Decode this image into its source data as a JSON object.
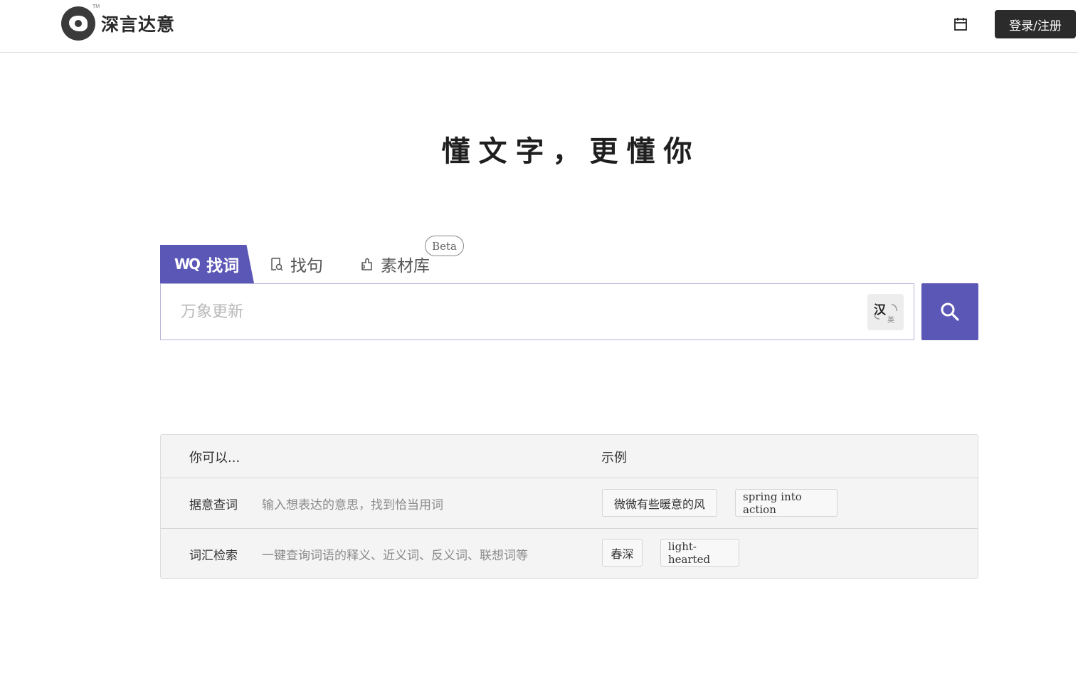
{
  "header": {
    "logo_text": "深言达意",
    "logo_tm": "TM",
    "login_label": "登录/注册"
  },
  "slogan": "懂文字，更懂你",
  "tabs": [
    {
      "label": "找词",
      "icon": "word-search-icon",
      "active": true
    },
    {
      "label": "找句",
      "icon": "sentence-search-icon",
      "active": false
    },
    {
      "label": "素材库",
      "icon": "puzzle-icon",
      "active": false
    }
  ],
  "beta_badge": "Beta",
  "search": {
    "placeholder": "万象更新",
    "value": "",
    "lang_toggle": {
      "primary": "汉",
      "secondary": "英"
    }
  },
  "guide": {
    "col_you_can": "你可以...",
    "col_example": "示例",
    "rows": [
      {
        "name": "据意查词",
        "desc": "输入想表达的意思，找到恰当用词",
        "examples": [
          "微微有些暖意的风",
          "spring into action"
        ]
      },
      {
        "name": "词汇检索",
        "desc": "一键查询词语的释义、近义词、反义词、联想词等",
        "examples": [
          "春深",
          "light-hearted"
        ]
      }
    ]
  },
  "colors": {
    "accent": "#5b57b6",
    "dark_button": "#2b2b2b",
    "table_bg": "#f4f4f4"
  }
}
